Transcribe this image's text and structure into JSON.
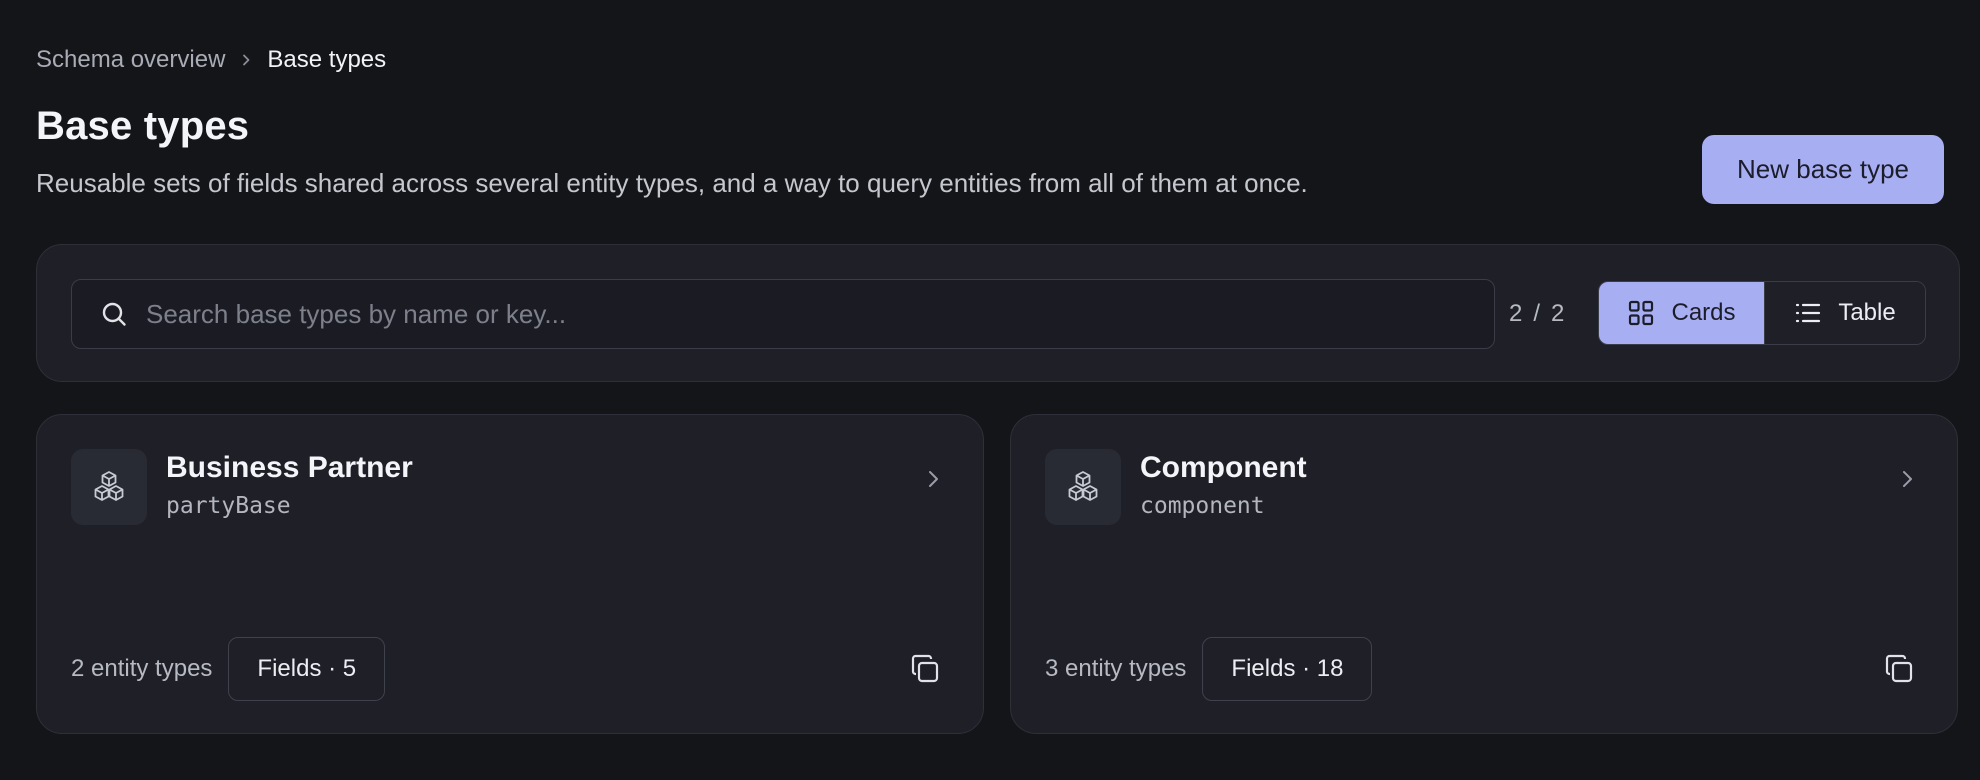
{
  "breadcrumb": {
    "parent": "Schema overview",
    "current": "Base types"
  },
  "header": {
    "title": "Base types",
    "description": "Reusable sets of fields shared across several entity types, and a way to query entities from all of them at once.",
    "new_button_label": "New base type"
  },
  "toolbar": {
    "search_placeholder": "Search base types by name or key...",
    "search_value": "",
    "count_shown": "2",
    "count_separator": "/",
    "count_total": "2",
    "views": [
      {
        "label": "Cards",
        "icon": "grid-icon",
        "active": true
      },
      {
        "label": "Table",
        "icon": "list-icon",
        "active": false
      }
    ]
  },
  "cards": [
    {
      "title": "Business Partner",
      "key": "partyBase",
      "icon": "cubes-icon",
      "entity_types": "2 entity types",
      "fields_label": "Fields · 5"
    },
    {
      "title": "Component",
      "key": "component",
      "icon": "cubes-icon",
      "entity_types": "3 entity types",
      "fields_label": "Fields · 18"
    }
  ],
  "colors": {
    "background": "#141519",
    "surface": "#1e1f27",
    "accent": "#a8aef2",
    "border": "#2d2f39"
  }
}
